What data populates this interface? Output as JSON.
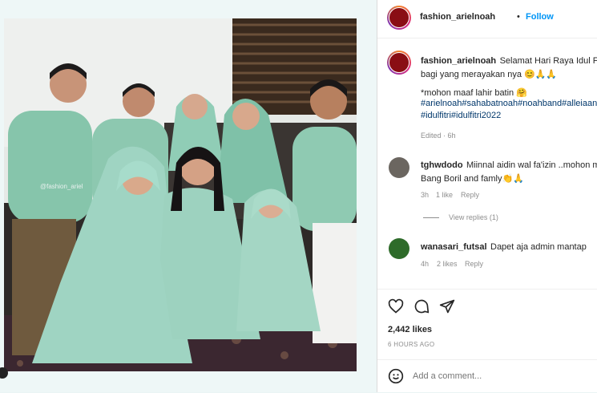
{
  "post": {
    "watermark": "@fashion_ariel"
  },
  "header": {
    "username": "fashion_arielnoah",
    "dot": "•",
    "follow_label": "Follow"
  },
  "caption": {
    "username": "fashion_arielnoah",
    "line1": "Selamat Hari Raya Idul Fitri",
    "line2": "bagi yang merayakan nya 😊🙏🙏",
    "line3": "*mohon maaf lahir batin 🤗",
    "hashtags_line1": "#arielnoah#sahabatnoah#noahband#alleiaan",
    "hashtags_line2": "#idulfitri#idulfitri2022",
    "edited": "Edited · 6h"
  },
  "comments": [
    {
      "username": "tghwdodo",
      "line1": "Miinnal aidin wal fa'izin ..mohon m",
      "line2": "Bang Boril and famly👏🙏",
      "time": "3h",
      "likes": "1 like",
      "reply": "Reply",
      "view_replies": "View replies (1)"
    },
    {
      "username": "wanasari_futsal",
      "text": "Dapet aja admin mantap",
      "time": "4h",
      "likes": "2 likes",
      "reply": "Reply"
    }
  ],
  "stats": {
    "likes": "2,442 likes",
    "time": "6 HOURS AGO"
  },
  "add_comment": {
    "placeholder": "Add a comment..."
  },
  "icons": [
    "heart-icon",
    "comment-icon",
    "share-icon",
    "emoji-icon"
  ],
  "colors": {
    "follow": "#0095f6",
    "hashtag": "#00376b",
    "muted": "#8e8e8e",
    "outfit": "#8fc9b3"
  }
}
